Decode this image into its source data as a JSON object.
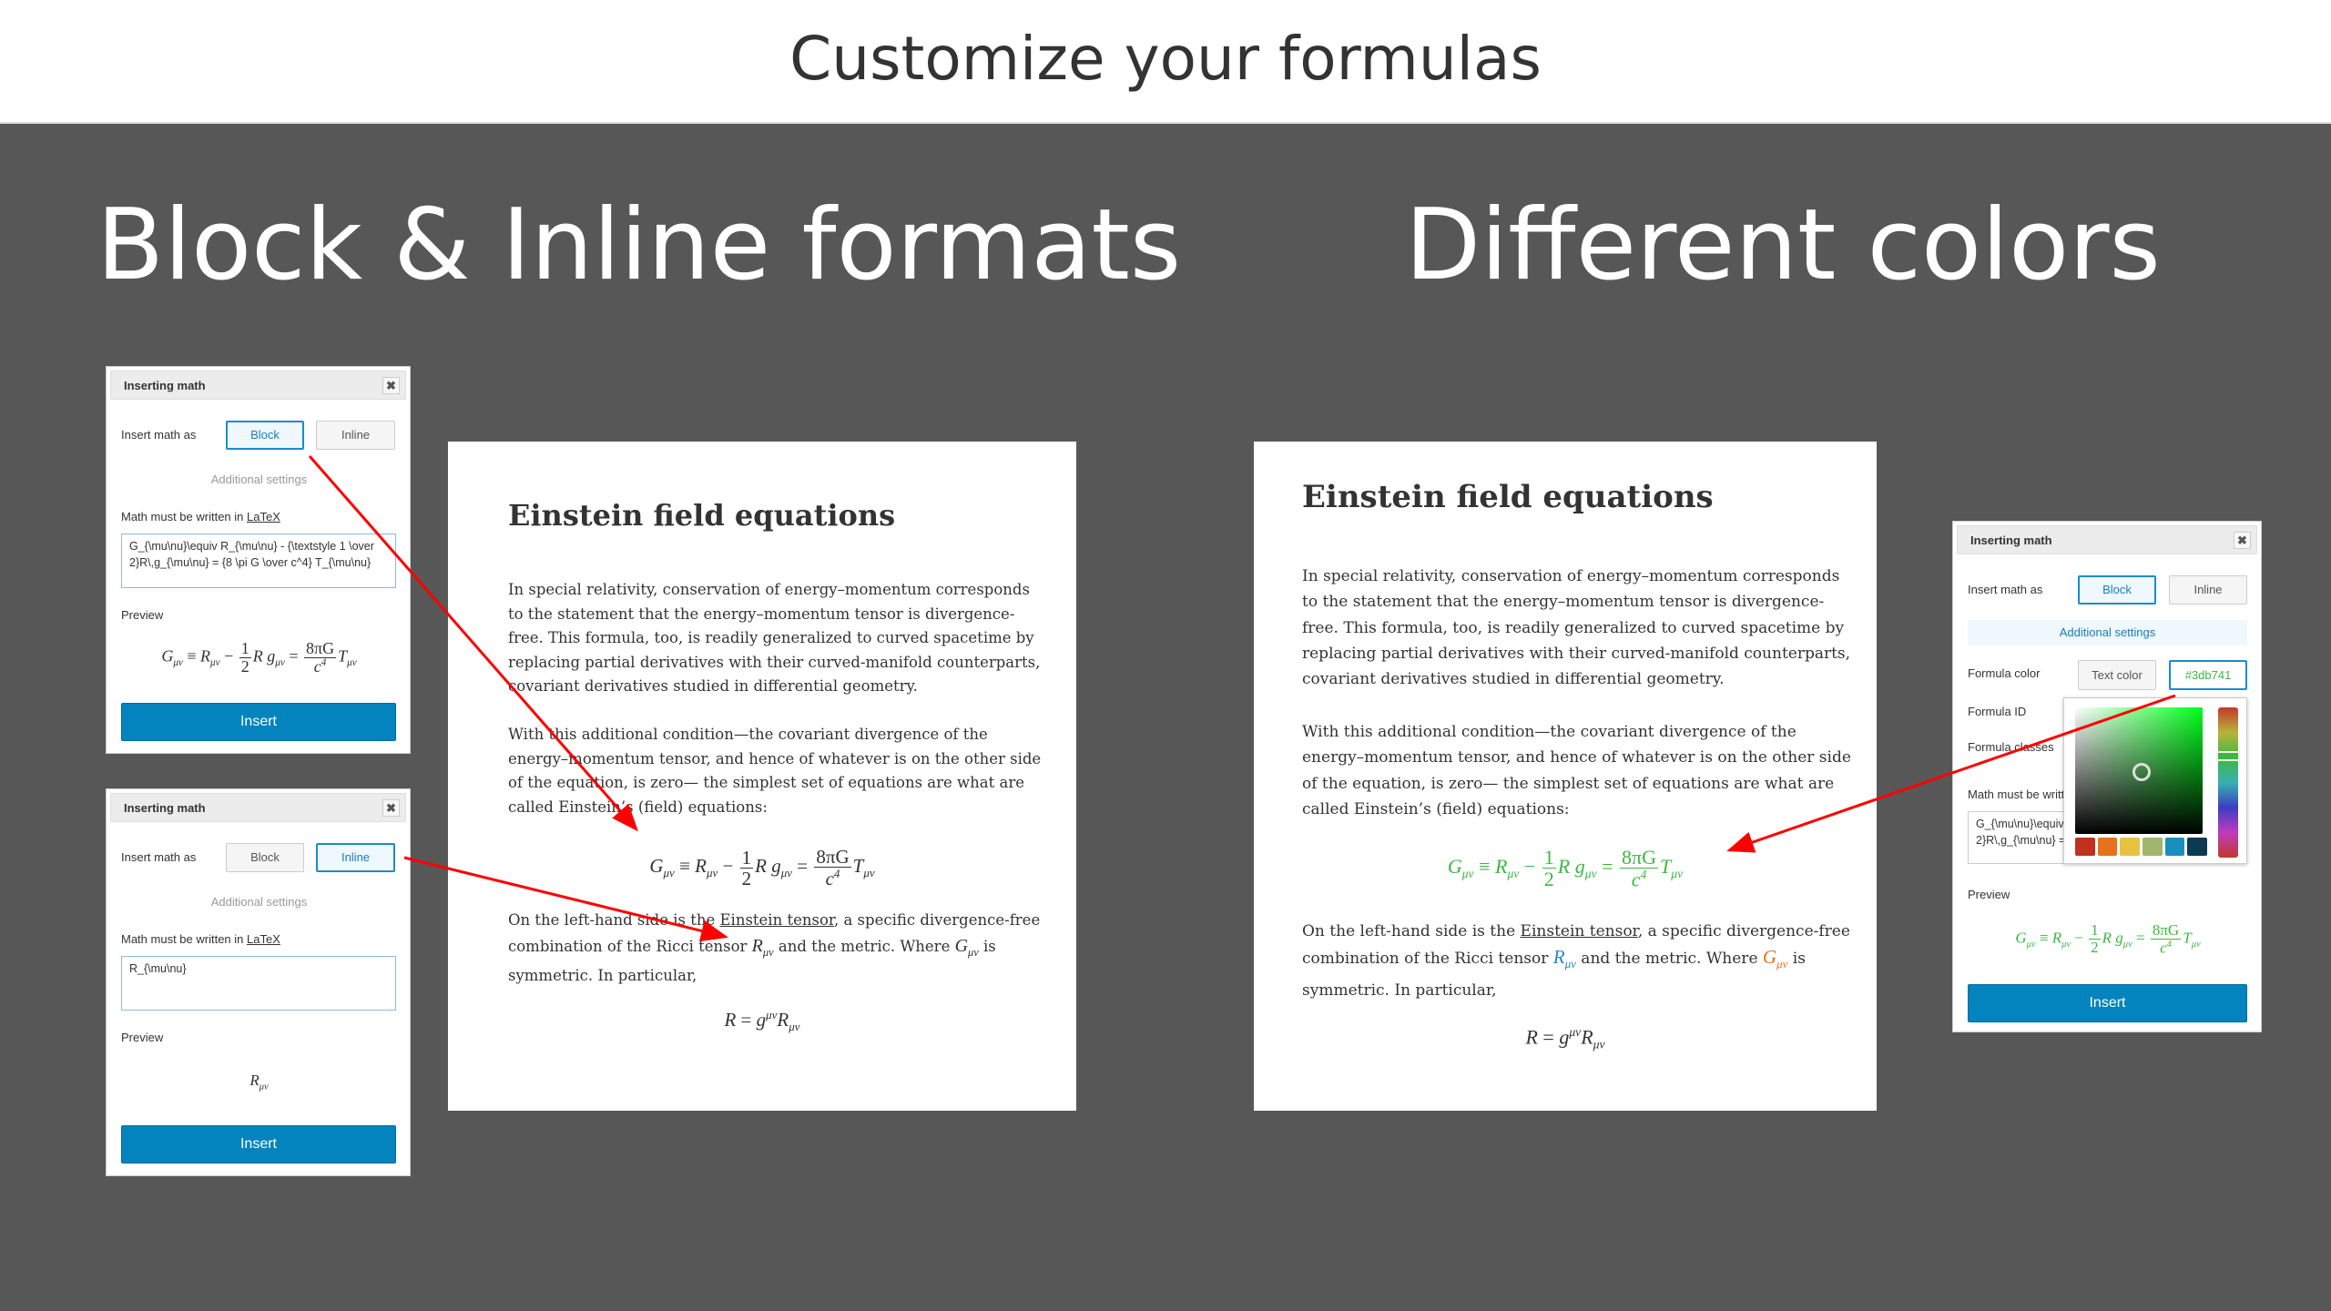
{
  "header": {
    "title": "Customize your formulas"
  },
  "sections": {
    "left": "Block & Inline formats",
    "right": "Different colors"
  },
  "colors": {
    "accent": "#0384be",
    "formula_green": "#3db741",
    "ricci_blue": "#1e8bc3",
    "g_orange": "#e8711c",
    "arrow": "#ff0000"
  },
  "dialog": {
    "title": "Inserting math",
    "close_icon": "close-icon",
    "insert_as": "Insert math as",
    "block": "Block",
    "inline": "Inline",
    "additional": "Additional settings",
    "latex_prefix": "Math must be written in ",
    "latex_link": "LaTeX",
    "preview": "Preview",
    "insert": "Insert",
    "formula_color": "Formula color",
    "text_color": "Text color",
    "color_value": "#3db741",
    "formula_id": "Formula ID",
    "formula_classes": "Formula classes",
    "latex_short": "Math must be writt"
  },
  "dialog1": {
    "textarea": "G_{\\mu\\nu}\\equiv R_{\\mu\\nu} - {\\textstyle 1 \\over 2}R\\,g_{\\mu\\nu} = {8 \\pi G \\over c^4} T_{\\mu\\nu}"
  },
  "dialog2": {
    "textarea": "R_{\\mu\\nu}"
  },
  "dialog3": {
    "textarea_l1": "G_{\\mu\\nu}\\equiv",
    "textarea_l2": "2}R\\,g_{\\mu\\nu} =",
    "swatches": [
      "#c0311f",
      "#e8711c",
      "#e8c340",
      "#a1b56c",
      "#1a8fbf",
      "#0b3a52"
    ],
    "picker_hue": "green"
  },
  "article": {
    "title": "Einstein field equations",
    "p1": "In special relativity, conservation of energy–momentum corresponds to the statement that the energy–momentum tensor is divergence-free. This formula, too, is readily generalized to curved spacetime by replacing partial derivatives with their curved-manifold counterparts, covariant derivatives studied in differential geometry.",
    "p2": "With this additional condition—the covariant divergence of the energy–momentum tensor, and hence of whatever is on the other side of the equation, is zero— the simplest set of equations are what are called Einstein’s (field) equations:",
    "p3a": "On the left-hand side is the ",
    "p3link": "Einstein tensor",
    "p3b": ", a specific divergence-free combination of the Ricci tensor ",
    "p3c": " and the metric. Where ",
    "p3d": " is symmetric. In particular,"
  },
  "math": {
    "G": "G",
    "R": "R",
    "g": "g",
    "T": "T",
    "mn": "μν",
    "equiv": "≡",
    "minus": "−",
    "eq": "=",
    "one": "1",
    "two": "2",
    "num": "8πG",
    "c": "c",
    "four": "4"
  }
}
